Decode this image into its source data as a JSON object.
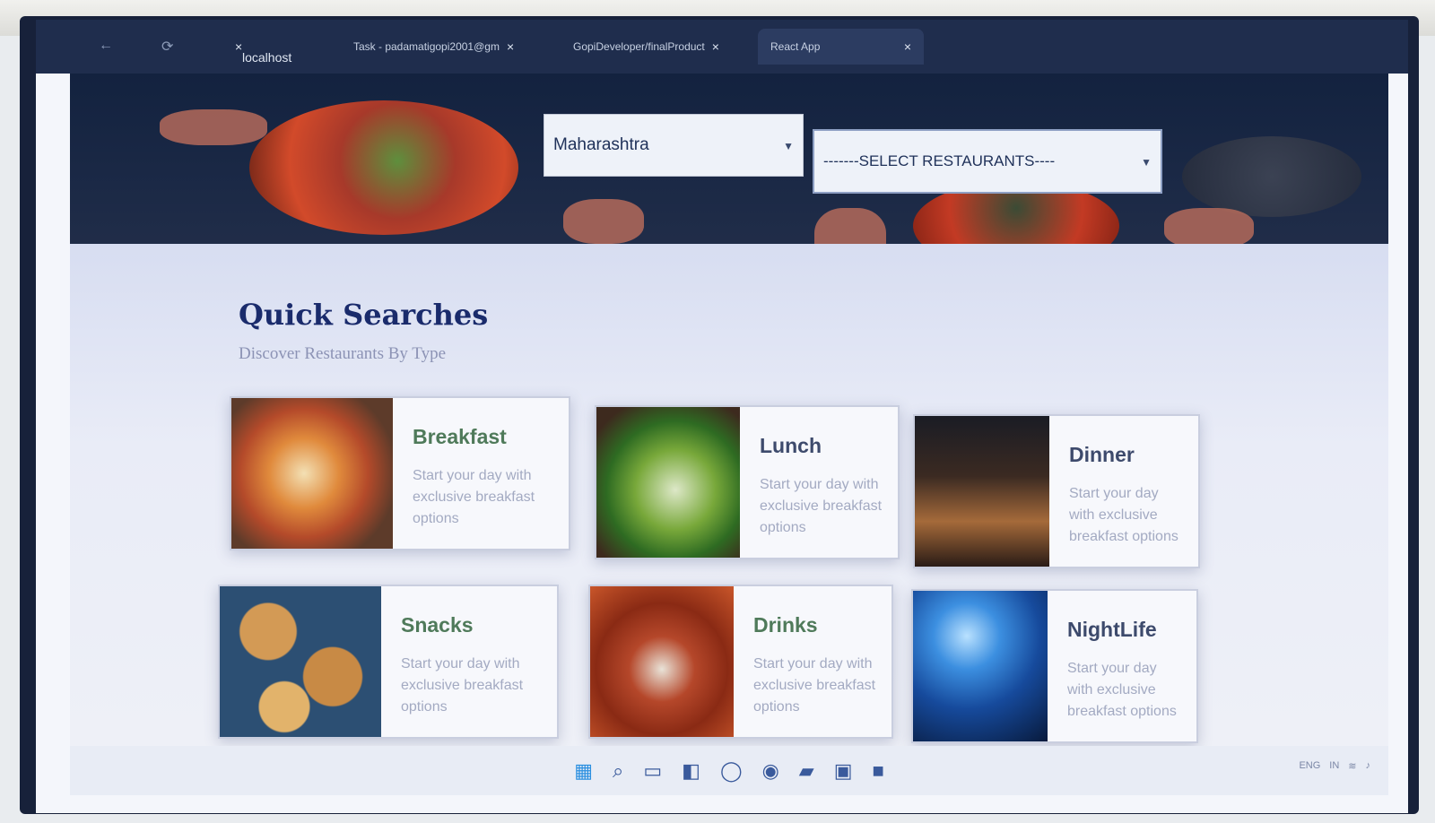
{
  "browser": {
    "tabs": [
      {
        "label": "",
        "close": "×"
      },
      {
        "label": "Task - padamatigopi2001@gm",
        "close": "×"
      },
      {
        "label": "GopiDeveloper/finalProduct",
        "close": "×"
      },
      {
        "label": "React App",
        "close": "×"
      }
    ],
    "address": "localhost",
    "new_tab": "+"
  },
  "hero": {
    "state_select": {
      "value": "Maharashtra"
    },
    "restaurant_select": {
      "value": "-------SELECT RESTAURANTS----"
    }
  },
  "quick_searches": {
    "title": "Quick Searches",
    "subtitle": "Discover Restaurants By Type",
    "cards": [
      {
        "name": "Breakfast",
        "desc": "Start your day with exclusive breakfast options",
        "icon": "breakfast-image"
      },
      {
        "name": "Lunch",
        "desc": "Start your day with exclusive breakfast options",
        "icon": "lunch-image"
      },
      {
        "name": "Dinner",
        "desc": "Start your day with exclusive breakfast options",
        "icon": "dinner-image"
      },
      {
        "name": "Snacks",
        "desc": "Start your day with exclusive breakfast options",
        "icon": "snacks-image"
      },
      {
        "name": "Drinks",
        "desc": "Start your day with exclusive breakfast options",
        "icon": "drinks-image"
      },
      {
        "name": "NightLife",
        "desc": "Start your day with exclusive breakfast options",
        "icon": "nightlife-image"
      }
    ]
  },
  "taskbar": {
    "tray": [
      "ENG",
      "IN"
    ]
  },
  "colors": {
    "title": "#1a2b6c",
    "card_name": "#3d4a6c",
    "card_desc": "#a3aac2"
  }
}
